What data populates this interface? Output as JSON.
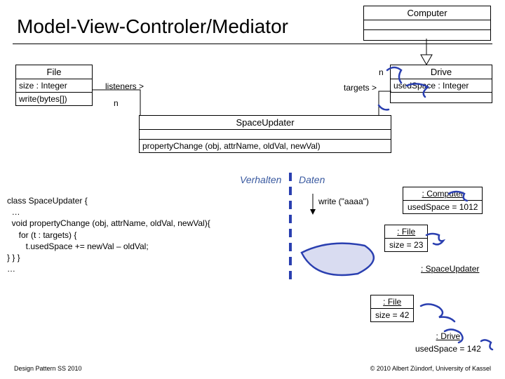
{
  "title": "Model-View-Controler/Mediator",
  "classes": {
    "computer": {
      "name": "Computer"
    },
    "file": {
      "name": "File",
      "attr": "size : Integer",
      "op": "write(bytes[])"
    },
    "drive": {
      "name": "Drive",
      "attr": "usedSpace : Integer"
    },
    "spaceupdater": {
      "name": "SpaceUpdater",
      "op": "propertyChange (obj, attrName, oldVal, newVal)"
    }
  },
  "assoc": {
    "listeners": {
      "label": "listeners >",
      "mult": "n"
    },
    "targets": {
      "label": "targets >",
      "mult": "n"
    }
  },
  "section": {
    "left": "Verhalten",
    "right": "Daten"
  },
  "code": "class SpaceUpdater {\n  …\n  void propertyChange (obj, attrName, oldVal, newVal){\n     for (t : targets) {\n        t.usedSpace += newVal – oldVal;\n} } }\n…",
  "writecall": "write (\"aaaa\")",
  "objects": {
    "computer": {
      "name": ": Computer",
      "attr": "usedSpace = 1012"
    },
    "file1": {
      "name": ": File",
      "attr": "size = 23"
    },
    "file2": {
      "name": ": File",
      "attr": "size = 42"
    },
    "spaceupdater": {
      "name": ": SpaceUpdater"
    },
    "drive": {
      "name": ": Drive",
      "attr": "usedSpace = 142"
    }
  },
  "footer": {
    "left": "Design Pattern SS 2010",
    "right": "© 2010 Albert Zündorf, University of Kassel"
  }
}
